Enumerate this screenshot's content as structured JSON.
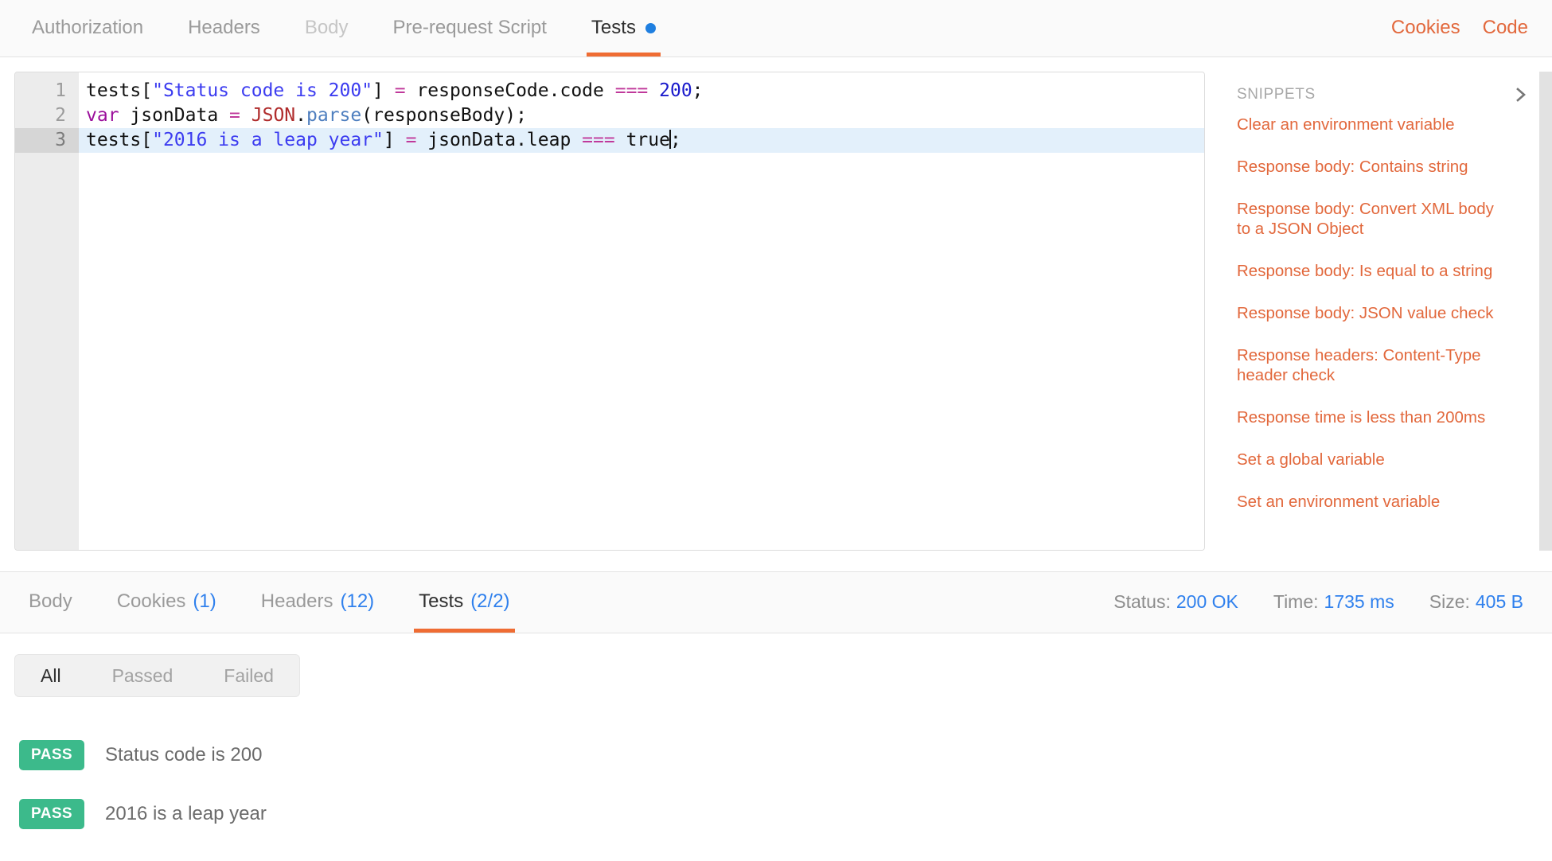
{
  "request_tabs": {
    "items": [
      {
        "label": "Authorization",
        "state": "normal"
      },
      {
        "label": "Headers",
        "state": "normal"
      },
      {
        "label": "Body",
        "state": "dim"
      },
      {
        "label": "Pre-request Script",
        "state": "normal"
      },
      {
        "label": "Tests",
        "state": "active",
        "dot": true
      }
    ],
    "actions": [
      {
        "label": "Cookies"
      },
      {
        "label": "Code"
      }
    ]
  },
  "editor": {
    "lines": [
      {
        "number": "1",
        "current": false
      },
      {
        "number": "2",
        "current": false
      },
      {
        "number": "3",
        "current": true
      }
    ],
    "line1": {
      "p1": "tests[",
      "str": "\"Status code is 200\"",
      "p2": "] ",
      "op1": "=",
      "p3": " responseCode.code ",
      "op2": "===",
      "p4": " ",
      "num": "200",
      "p5": ";"
    },
    "line2": {
      "kw": "var",
      "p1": " jsonData ",
      "op1": "=",
      "p2": " ",
      "cls": "JSON",
      "p3": ".",
      "fn": "parse",
      "p4": "(responseBody);"
    },
    "line3": {
      "p1": "tests[",
      "str": "\"2016 is a leap year\"",
      "p2": "] ",
      "op1": "=",
      "p3": " jsonData.leap ",
      "op2": "===",
      "p4": " true",
      "p5": ";"
    },
    "full_text": "tests[\"Status code is 200\"] = responseCode.code === 200;\nvar jsonData = JSON.parse(responseBody);\ntests[\"2016 is a leap year\"] = jsonData.leap === true;"
  },
  "snippets": {
    "title": "SNIPPETS",
    "items": [
      "Clear an environment variable",
      "Response body: Contains string",
      "Response body: Convert XML body to a JSON Object",
      "Response body: Is equal to a string",
      "Response body: JSON value check",
      "Response headers: Content-Type header check",
      "Response time is less than 200ms",
      "Set a global variable",
      "Set an environment variable"
    ]
  },
  "response_tabs": {
    "items": [
      {
        "label": "Body",
        "count": "",
        "state": "normal"
      },
      {
        "label": "Cookies",
        "count": "(1)",
        "state": "normal"
      },
      {
        "label": "Headers",
        "count": "(12)",
        "state": "normal"
      },
      {
        "label": "Tests",
        "count": "(2/2)",
        "state": "active"
      }
    ],
    "meta": [
      {
        "label": "Status:",
        "value": "200 OK"
      },
      {
        "label": "Time:",
        "value": "1735 ms"
      },
      {
        "label": "Size:",
        "value": "405 B"
      }
    ]
  },
  "test_results": {
    "filters": [
      {
        "label": "All",
        "state": "active"
      },
      {
        "label": "Passed",
        "state": "normal"
      },
      {
        "label": "Failed",
        "state": "normal"
      }
    ],
    "rows": [
      {
        "status": "PASS",
        "name": "Status code is 200"
      },
      {
        "status": "PASS",
        "name": "2016 is a leap year"
      }
    ]
  },
  "colors": {
    "accent_orange": "#ef6c33",
    "link_blue": "#2f80ed",
    "pass_green": "#3cba8b",
    "snippet_orange": "#e2683c"
  }
}
